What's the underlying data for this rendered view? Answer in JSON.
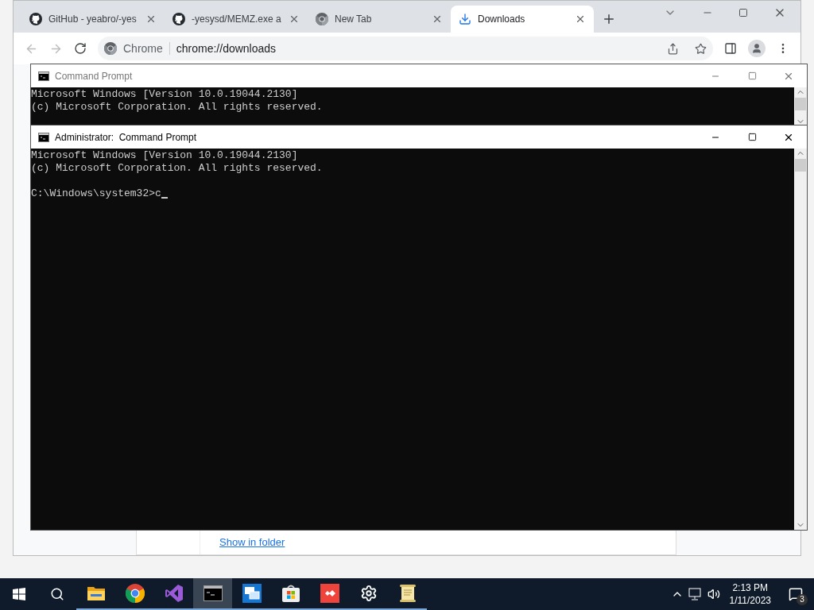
{
  "browser": {
    "tabs": [
      {
        "title": "GitHub - yeabro/-yes",
        "kind": "github",
        "selected": false
      },
      {
        "title": "-yesysd/MEMZ.exe a",
        "kind": "github",
        "selected": false
      },
      {
        "title": "New Tab",
        "kind": "chrome",
        "selected": false
      },
      {
        "title": "Downloads",
        "kind": "download",
        "selected": true
      }
    ],
    "omnibox": {
      "site_label": "Chrome",
      "url": "chrome://downloads"
    },
    "downloads": {
      "link": "Show in folder"
    }
  },
  "cmd_windows": [
    {
      "title": "Command Prompt",
      "active": false,
      "lines": [
        "Microsoft Windows [Version 10.0.19044.2130]",
        "(c) Microsoft Corporation. All rights reserved."
      ]
    },
    {
      "title": "Administrator:  Command Prompt",
      "active": true,
      "lines": [
        "Microsoft Windows [Version 10.0.19044.2130]",
        "(c) Microsoft Corporation. All rights reserved."
      ],
      "prompt": "C:\\Windows\\system32>c"
    }
  ],
  "taskbar": {
    "apps": [
      {
        "kind": "explorer",
        "active": false
      },
      {
        "kind": "chrome",
        "active": false
      },
      {
        "kind": "studio",
        "active": false
      },
      {
        "kind": "terminal",
        "active": true
      },
      {
        "kind": "remote",
        "active": false
      },
      {
        "kind": "store",
        "active": false
      },
      {
        "kind": "remote-red",
        "active": false
      },
      {
        "kind": "settings",
        "active": false
      },
      {
        "kind": "notepad",
        "active": false
      }
    ],
    "clock": {
      "time": "2:13 PM",
      "date": "1/11/2023"
    },
    "notifications": "3"
  }
}
